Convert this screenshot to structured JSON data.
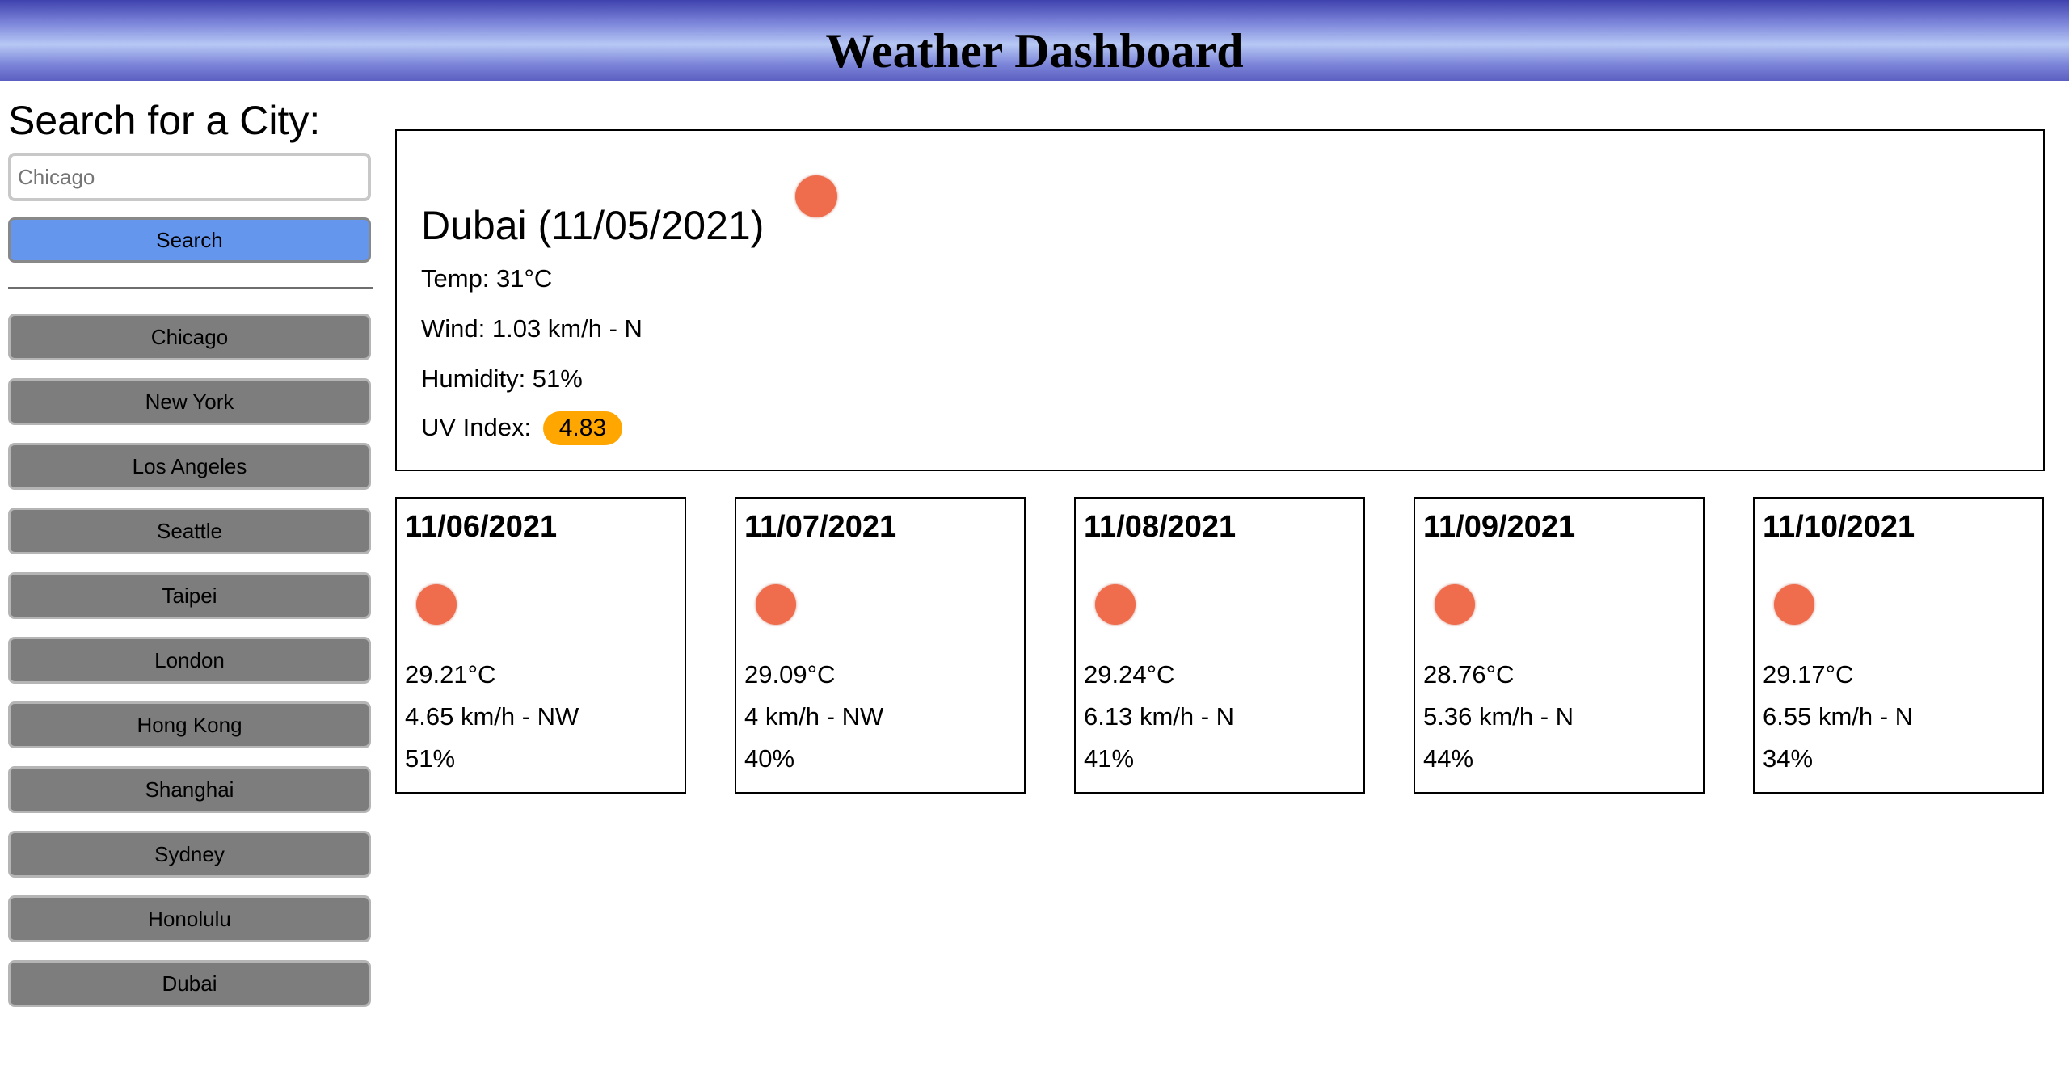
{
  "header": {
    "title": "Weather Dashboard"
  },
  "search": {
    "label": "Search for a City:",
    "placeholder": "Chicago",
    "value": "",
    "button_label": "Search"
  },
  "history": [
    {
      "label": "Chicago"
    },
    {
      "label": "New York"
    },
    {
      "label": "Los Angeles"
    },
    {
      "label": "Seattle"
    },
    {
      "label": "Taipei"
    },
    {
      "label": "London"
    },
    {
      "label": "Hong Kong"
    },
    {
      "label": "Shanghai"
    },
    {
      "label": "Sydney"
    },
    {
      "label": "Honolulu"
    },
    {
      "label": "Dubai"
    }
  ],
  "current": {
    "title": "Dubai (11/05/2021)",
    "icon": "sun-icon",
    "temp": "Temp: 31°C",
    "wind": "Wind: 1.03 km/h - N",
    "humidity": "Humidity: 51%",
    "uv_label": "UV Index:",
    "uv_value": "4.83",
    "uv_color": "#ffa600"
  },
  "forecast": [
    {
      "date": "11/06/2021",
      "icon": "sun-icon",
      "temp": "29.21°C",
      "wind": "4.65 km/h - NW",
      "humidity": "51%"
    },
    {
      "date": "11/07/2021",
      "icon": "sun-icon",
      "temp": "29.09°C",
      "wind": "4 km/h - NW",
      "humidity": "40%"
    },
    {
      "date": "11/08/2021",
      "icon": "sun-icon",
      "temp": "29.24°C",
      "wind": "6.13 km/h - N",
      "humidity": "41%"
    },
    {
      "date": "11/09/2021",
      "icon": "sun-icon",
      "temp": "28.76°C",
      "wind": "5.36 km/h - N",
      "humidity": "44%"
    },
    {
      "date": "11/10/2021",
      "icon": "sun-icon",
      "temp": "29.17°C",
      "wind": "6.55 km/h - N",
      "humidity": "34%"
    }
  ],
  "colors": {
    "header_gradient_mid": "#b7c8f4",
    "header_gradient_edge": "#3f42ae",
    "search_button": "#6496ee",
    "history_button": "#7d7d7d",
    "sun": "#ef6c4c"
  }
}
